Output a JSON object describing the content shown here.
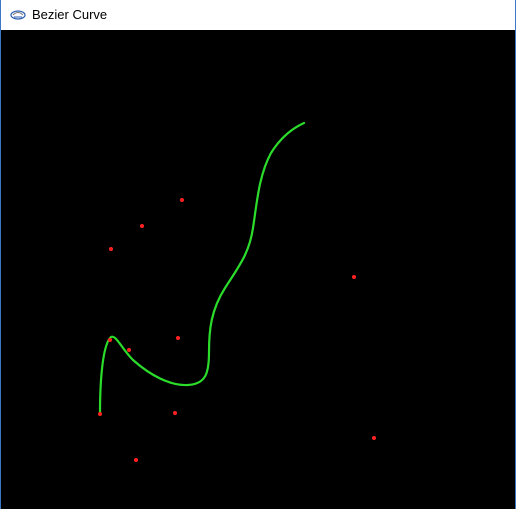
{
  "window": {
    "title": "Bezier Curve",
    "app_icon": "opengl-app-icon"
  },
  "colors": {
    "background": "#000000",
    "curve": "#2bdc2b",
    "control_point": "#ff2020",
    "titlebar": "#ffffff",
    "border": "#3b78c4"
  },
  "scene": {
    "description_items": [
      "bezier-curve",
      "control-points"
    ]
  }
}
